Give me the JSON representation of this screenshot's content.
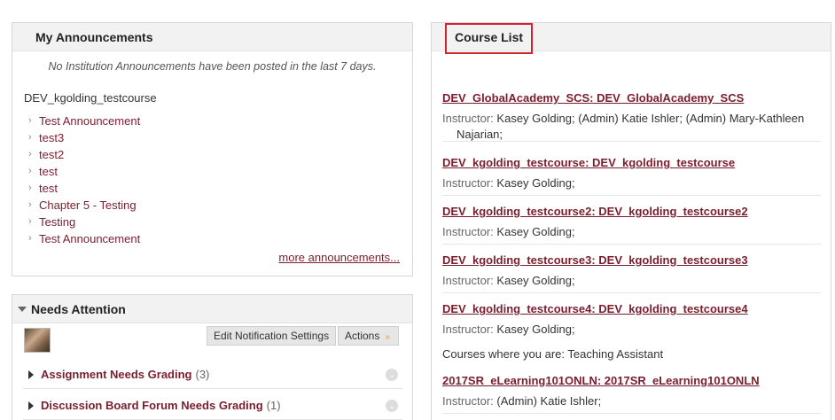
{
  "announcements": {
    "title": "My Announcements",
    "no_institution": "No Institution Announcements have been posted in the last 7 days.",
    "course": "DEV_kgolding_testcourse",
    "items": [
      {
        "label": "Test Announcement"
      },
      {
        "label": "test3"
      },
      {
        "label": "test2"
      },
      {
        "label": "test"
      },
      {
        "label": "test"
      },
      {
        "label": "Chapter 5 - Testing"
      },
      {
        "label": "Testing"
      },
      {
        "label": "Test Announcement"
      }
    ],
    "more": "more announcements..."
  },
  "needs_attention": {
    "title": "Needs Attention",
    "edit_button": "Edit Notification Settings",
    "actions_button": "Actions",
    "rows": [
      {
        "label": "Assignment Needs Grading",
        "count": "(3)"
      },
      {
        "label": "Discussion Board Forum Needs Grading",
        "count": "(1)"
      }
    ]
  },
  "course_list": {
    "title": "Course List",
    "courses": [
      {
        "title": "DEV_GlobalAcademy_SCS: DEV_GlobalAcademy_SCS",
        "instructor_label": "Instructor:",
        "instructors": "Kasey Golding;  (Admin) Katie Ishler;  (Admin) Mary-Kathleen",
        "instructors_cont": "Najarian;"
      },
      {
        "title": "DEV_kgolding_testcourse: DEV_kgolding_testcourse",
        "instructor_label": "Instructor:",
        "instructors": "Kasey Golding;"
      },
      {
        "title": "DEV_kgolding_testcourse2: DEV_kgolding_testcourse2",
        "instructor_label": "Instructor:",
        "instructors": "Kasey Golding;"
      },
      {
        "title": "DEV_kgolding_testcourse3: DEV_kgolding_testcourse3",
        "instructor_label": "Instructor:",
        "instructors": "Kasey Golding;"
      },
      {
        "title": "DEV_kgolding_testcourse4: DEV_kgolding_testcourse4",
        "instructor_label": "Instructor:",
        "instructors": "Kasey Golding;"
      }
    ],
    "role_heading": "Courses where you are: Teaching Assistant",
    "ta_courses": [
      {
        "title": "2017SR_eLearning101ONLN: 2017SR_eLearning101ONLN",
        "instructor_label": "Instructor:",
        "instructors": "(Admin) Katie Ishler;"
      }
    ]
  }
}
